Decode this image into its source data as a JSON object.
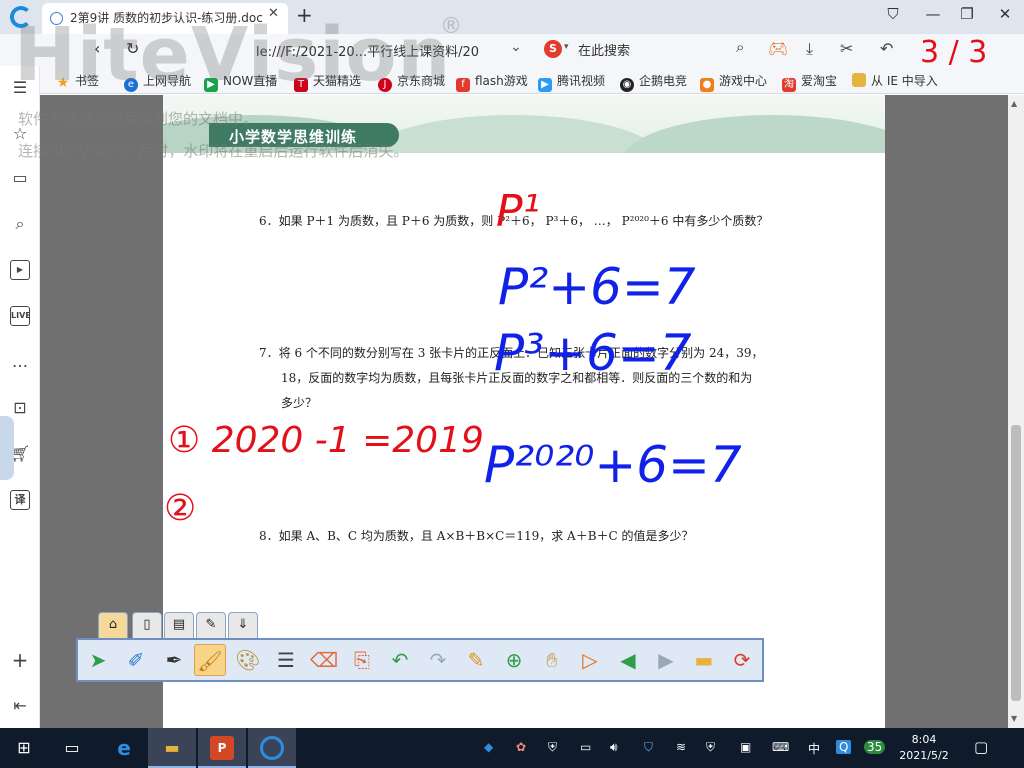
{
  "browser": {
    "tab_title": "2第9讲 质数的初步认识-练习册.doc",
    "url_text": "le:///F:/2021-20...平行线上课资料/20",
    "search_placeholder": "在此搜索",
    "bookmarks": [
      {
        "label": "书签",
        "icon": "star-icon",
        "color": "#f0a020"
      },
      {
        "label": "上网导航",
        "icon": "ie-icon",
        "color": "#1a6fd6"
      },
      {
        "label": "NOW直播",
        "icon": "play-icon",
        "color": "#16a34a"
      },
      {
        "label": "天猫精选",
        "icon": "tmall-icon",
        "color": "#d0021b"
      },
      {
        "label": "京东商城",
        "icon": "jd-icon",
        "color": "#d0021b"
      },
      {
        "label": "flash游戏",
        "icon": "flash-icon",
        "color": "#e23a2e"
      },
      {
        "label": "腾讯视频",
        "icon": "video-icon",
        "color": "#2e9bf0"
      },
      {
        "label": "企鹅电竞",
        "icon": "penguin-icon",
        "color": "#222222"
      },
      {
        "label": "游戏中心",
        "icon": "gamepad-icon",
        "color": "#f07f1a"
      },
      {
        "label": "爱淘宝",
        "icon": "taobao-icon",
        "color": "#e23a2e"
      },
      {
        "label": "从 IE 中导入",
        "icon": "folder-icon",
        "color": "#e6b341"
      }
    ]
  },
  "watermark": {
    "logo": "HiteVision",
    "reg": "®",
    "line1": "软件不会将水印保存到您的文档中。",
    "line2": "连接HiteVision产品时，水印将在重启后运行软件后消失。"
  },
  "document": {
    "banner_title": "小学数学思维训练",
    "q6": "6．如果 P＋1 为质数，且 P＋6 为质数，则 P²＋6， P³＋6， …， P²⁰²⁰＋6 中有多少个质数？",
    "q7_line1": "7．将 6 个不同的数分别写在 3 张卡片的正反面上．已知三张卡片正面的数字分别为 24，39，",
    "q7_line2": "18，反面的数字均为质数，且每张卡片正反面的数字之和都相等．则反面的三个数的和为",
    "q7_line3": "多少？",
    "q8": "8．如果 A、B、C 均为质数，且 A×B＋B×C＝119，求 A＋B＋C 的值是多少？"
  },
  "annotations": {
    "red_top": "P¹",
    "blue_1": "P²+6=7",
    "blue_2": "P³+6=7",
    "blue_3": "P²⁰²⁰+6=7",
    "red_1": "① 2020 -1 =2019",
    "red_2": "②",
    "page_nav": "3 / 3"
  },
  "taskbar": {
    "time": "8:04",
    "date": "2021/5/2",
    "ime": "中",
    "badge": "35"
  }
}
